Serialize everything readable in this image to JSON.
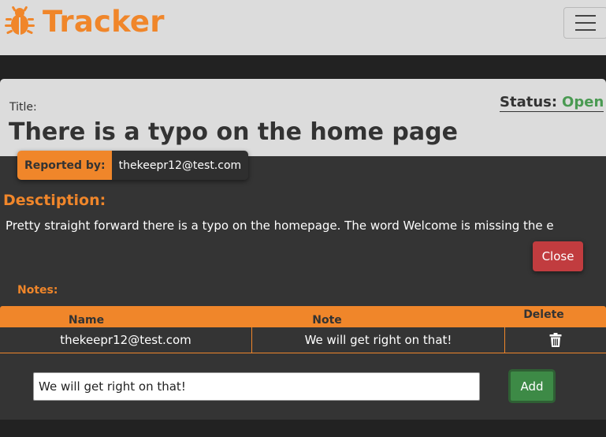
{
  "navbar": {
    "brand": "Tracker",
    "brand_icon": "bug-icon",
    "menu_icon": "hamburger-icon",
    "accent_color": "#f0862a"
  },
  "bug": {
    "title_label": "Title:",
    "title": "There is a typo on the home page",
    "status_label": "Status:",
    "status": "Open",
    "status_color": "#4a9a52",
    "reported_by_label": "Reported by:",
    "reported_by": "thekeepr12@test.com",
    "description_heading": "Desctiption:",
    "description": "Pretty straight forward there is a typo on the homepage. The word Welcome is missing the e",
    "close_label": "Close"
  },
  "notes": {
    "heading": "Notes:",
    "columns": [
      "Name",
      "Note",
      "Delete"
    ],
    "rows": [
      {
        "name": "thekeepr12@test.com",
        "note": "We will get right on that!",
        "delete_icon": "trash-icon"
      }
    ],
    "input_value": "We will get right on that!",
    "add_label": "Add"
  }
}
